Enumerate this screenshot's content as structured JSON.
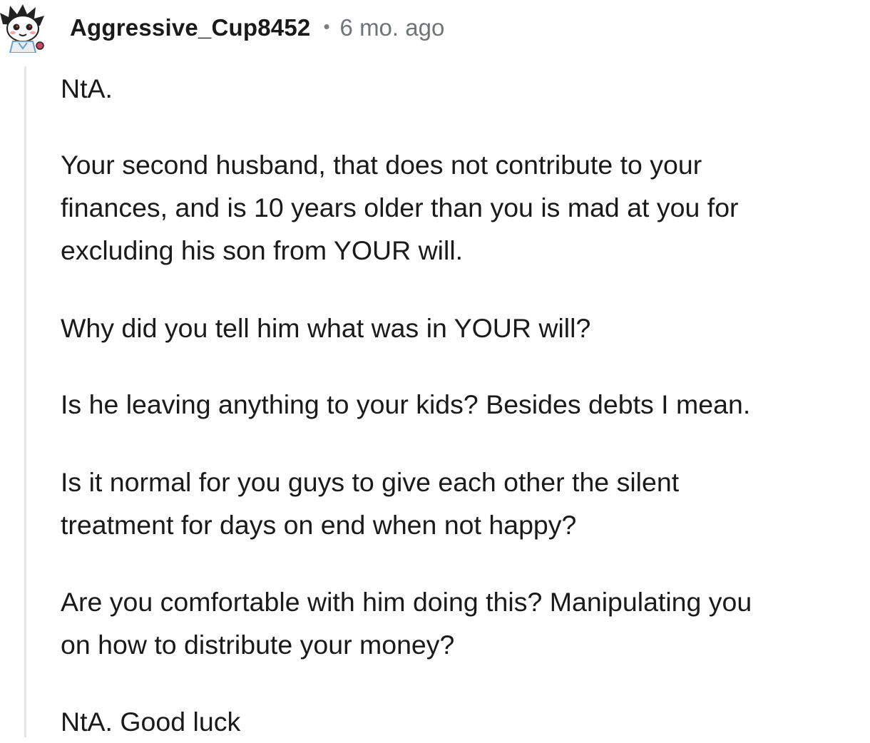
{
  "comment": {
    "author": "Aggressive_Cup8452",
    "separator": "•",
    "timestamp": "6 mo. ago",
    "avatar_icon": "snoo-avatar-icon",
    "paragraphs": [
      [
        "NtA."
      ],
      [
        "Your second husband, that does not contribute to your",
        "finances, and is 10 years older than you is mad at you for",
        "excluding his son from YOUR will."
      ],
      [
        "Why did you tell him what was in YOUR will?"
      ],
      [
        "Is he leaving anything to your kids? Besides debts I mean."
      ],
      [
        "Is it normal for you guys to give each other the silent",
        "treatment for days on end when not happy?"
      ],
      [
        "Are you comfortable with him doing this? Manipulating you",
        "on how to distribute your money?"
      ],
      [
        "NtA. Good luck"
      ]
    ]
  },
  "colors": {
    "text": "#1a1a1b",
    "meta": "#6f7479",
    "thread_line": "#e4e6e8",
    "avatar_accent": "#6aa0c8"
  }
}
